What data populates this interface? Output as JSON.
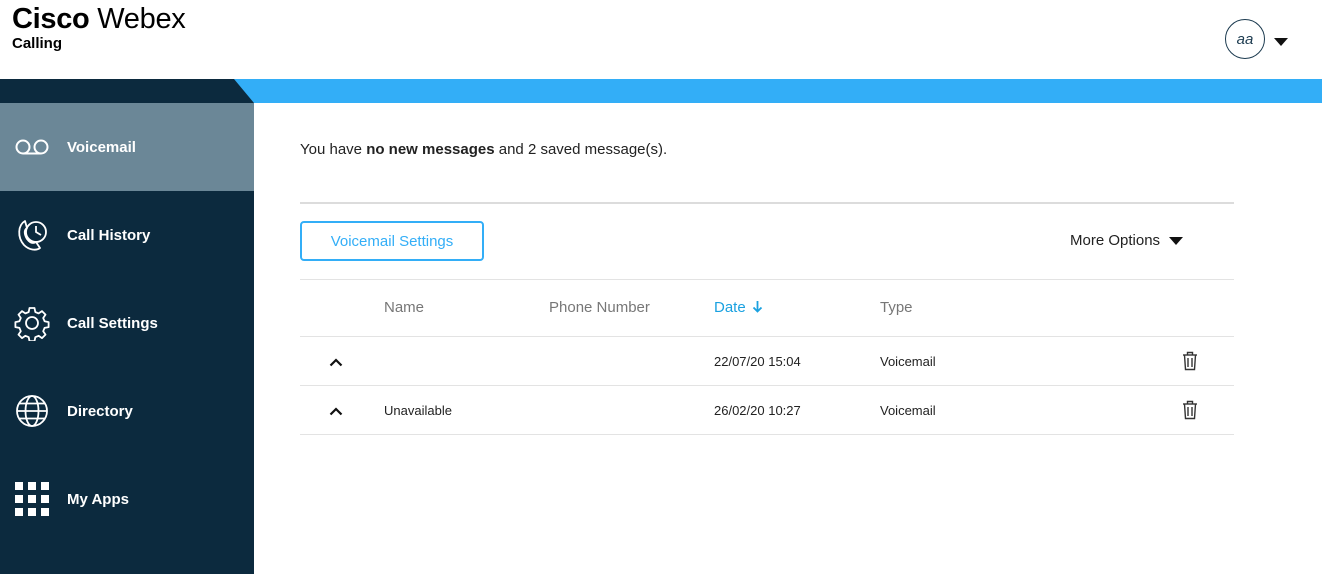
{
  "brand": {
    "name_bold": "Cisco",
    "name_light": "Webex",
    "product": "Calling"
  },
  "user": {
    "initials": "aa"
  },
  "sidebar": {
    "items": [
      {
        "label": "Voicemail",
        "icon": "voicemail-icon",
        "active": true
      },
      {
        "label": "Call History",
        "icon": "call-history-icon",
        "active": false
      },
      {
        "label": "Call Settings",
        "icon": "gear-icon",
        "active": false
      },
      {
        "label": "Directory",
        "icon": "globe-icon",
        "active": false
      },
      {
        "label": "My Apps",
        "icon": "apps-grid-icon",
        "active": false
      }
    ]
  },
  "summary": {
    "prefix": "You have ",
    "bold": "no new messages",
    "suffix": " and 2 saved message(s)."
  },
  "toolbar": {
    "settings_label": "Voicemail Settings",
    "more_options_label": "More Options"
  },
  "table": {
    "columns": {
      "name": "Name",
      "phone": "Phone Number",
      "date": "Date",
      "type": "Type"
    },
    "sorted_column": "date",
    "rows": [
      {
        "name": "",
        "phone": "",
        "date": "22/07/20 15:04",
        "type": "Voicemail"
      },
      {
        "name": "Unavailable",
        "phone": "",
        "date": "26/02/20 10:27",
        "type": "Voicemail"
      }
    ]
  },
  "colors": {
    "sidebar": "#0c2a3e",
    "active": "#6b8797",
    "accent": "#33aef7",
    "sort": "#1aa1e0"
  }
}
